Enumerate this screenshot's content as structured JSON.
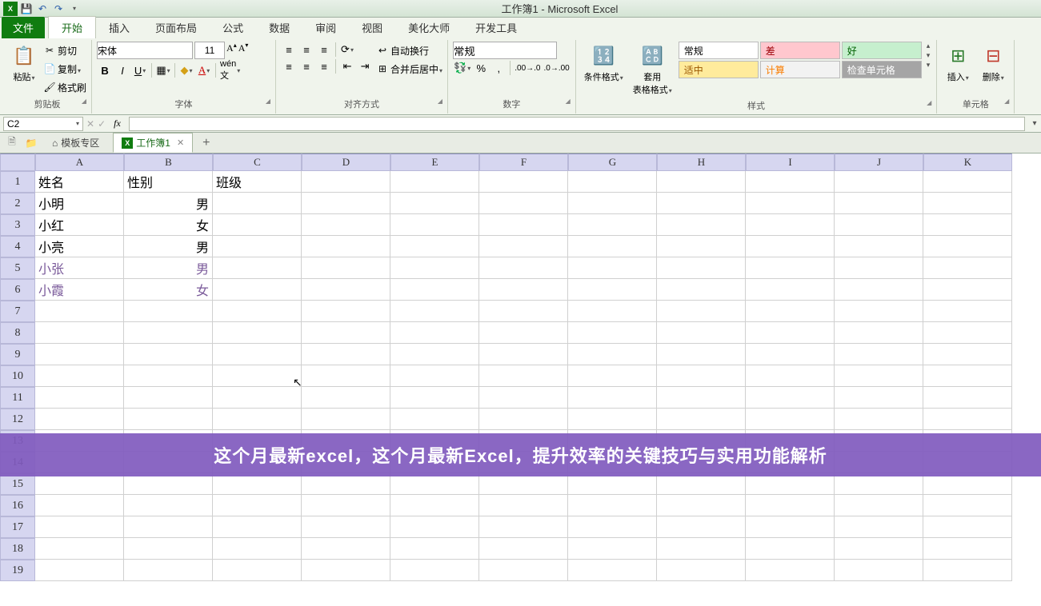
{
  "title": "工作簿1 - Microsoft Excel",
  "tabs": {
    "file": "文件",
    "items": [
      "开始",
      "插入",
      "页面布局",
      "公式",
      "数据",
      "审阅",
      "视图",
      "美化大师",
      "开发工具"
    ],
    "active": 0
  },
  "clipboard": {
    "paste": "粘贴",
    "cut": "剪切",
    "copy": "复制",
    "format": "格式刷",
    "label": "剪贴板"
  },
  "font": {
    "name": "宋体",
    "size": "11",
    "label": "字体"
  },
  "align": {
    "wrap": "自动换行",
    "merge": "合并后居中",
    "label": "对齐方式"
  },
  "number": {
    "format": "常规",
    "label": "数字"
  },
  "styles": {
    "cond": "条件格式",
    "table": "套用\n表格格式",
    "cells": [
      "常规",
      "差",
      "好",
      "适中",
      "计算",
      "检查单元格"
    ],
    "label": "样式"
  },
  "cells_group": {
    "insert": "插入",
    "delete": "删除",
    "label": "单元格"
  },
  "namebox": "C2",
  "doctabs": {
    "template": "模板专区",
    "wb": "工作簿1"
  },
  "columns": [
    "A",
    "B",
    "C",
    "D",
    "E",
    "F",
    "G",
    "H",
    "I",
    "J",
    "K"
  ],
  "rows": [
    "1",
    "2",
    "3",
    "4",
    "5",
    "6",
    "7",
    "8",
    "9",
    "10",
    "11",
    "12",
    "13",
    "14",
    "15",
    "16",
    "17",
    "18",
    "19"
  ],
  "data": {
    "A1": "姓名",
    "B1": "性别",
    "C1": "班级",
    "A2": "小明",
    "B2": "男",
    "A3": "小红",
    "B3": "女",
    "A4": "小亮",
    "B4": "男",
    "A5": "小张",
    "B5": "男",
    "A6": "小霞",
    "B6": "女"
  },
  "banner": "这个月最新excel，这个月最新Excel，提升效率的关键技巧与实用功能解析"
}
